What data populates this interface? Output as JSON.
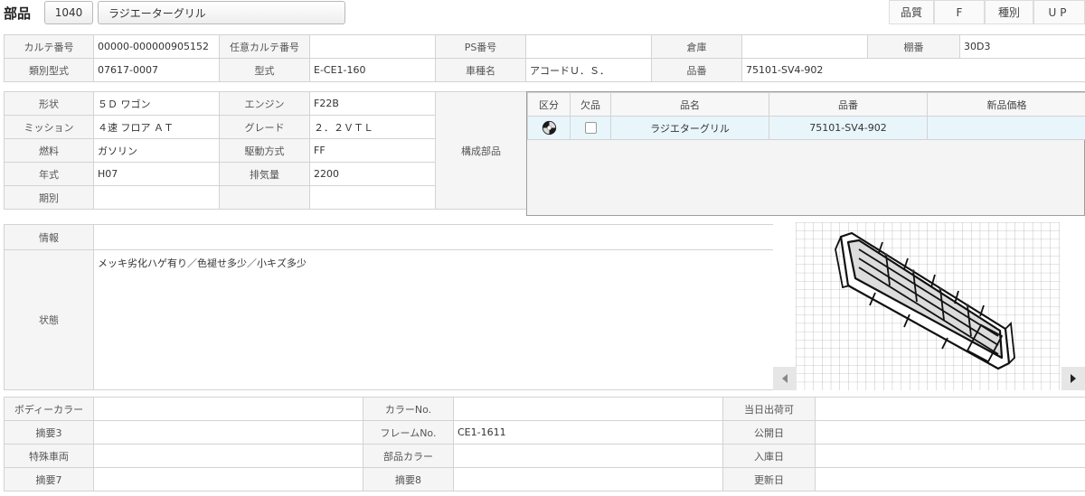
{
  "header": {
    "title": "部品",
    "part_id": "1040",
    "part_name": "ラジエーターグリル",
    "quality_label": "品質",
    "quality_value": "F",
    "kind_label": "種別",
    "kind_value": "UP"
  },
  "top": {
    "karte_no_label": "カルテ番号",
    "karte_no_value": "00000-000000905152",
    "optional_karte_label": "任意カルテ番号",
    "optional_karte_value": "",
    "ps_no_label": "PS番号",
    "ps_no_value": "",
    "warehouse_label": "倉庫",
    "warehouse_value": "",
    "shelf_label": "棚番",
    "shelf_value": "30D3",
    "type_spec_label": "類別型式",
    "type_spec_value": "07617-0007",
    "model_label": "型式",
    "model_value": "E-CE1-160",
    "vehicle_label": "車種名",
    "vehicle_value": "アコードＵ．Ｓ．",
    "part_no_label": "品番",
    "part_no_value": "75101-SV4-902"
  },
  "spec": {
    "shape_label": "形状",
    "shape_value": "５Ｄ ワゴン",
    "engine_label": "エンジン",
    "engine_value": "F22B",
    "mission_label": "ミッション",
    "mission_value": "４速 フロア ＡＴ",
    "grade_label": "グレード",
    "grade_value": "２．２ＶＴＬ",
    "fuel_label": "燃料",
    "fuel_value": "ガソリン",
    "drive_label": "駆動方式",
    "drive_value": "FF",
    "year_label": "年式",
    "year_value": "H07",
    "displacement_label": "排気量",
    "displacement_value": "2200",
    "period_label": "期別",
    "period_value": "",
    "components_label": "構成部品"
  },
  "parts_table": {
    "columns": [
      "区分",
      "欠品",
      "品名",
      "品番",
      "新品価格"
    ],
    "rows": [
      {
        "category_icon": "disc-icon",
        "missing": false,
        "name": "ラジエターグリル",
        "part_no": "75101-SV4-902",
        "price": ""
      }
    ]
  },
  "info": {
    "info_label": "情報",
    "info_value": "",
    "condition_label": "状態",
    "condition_value": "メッキ劣化ハゲ有り／色褪せ多少／小キズ多少"
  },
  "bottom": {
    "body_color_label": "ボディーカラー",
    "body_color_value": "",
    "color_no_label": "カラーNo.",
    "color_no_value": "",
    "same_day_label": "当日出荷可",
    "same_day_value": "",
    "memo3_label": "摘要3",
    "memo3_value": "",
    "frame_no_label": "フレームNo.",
    "frame_no_value": "CE1-1611",
    "public_date_label": "公開日",
    "public_date_value": "",
    "special_vehicle_label": "特殊車両",
    "special_vehicle_value": "",
    "part_color_label": "部品カラー",
    "part_color_value": "",
    "stock_date_label": "入庫日",
    "stock_date_value": "",
    "memo7_label": "摘要7",
    "memo7_value": "",
    "memo8_label": "摘要8",
    "memo8_value": "",
    "update_date_label": "更新日",
    "update_date_value": ""
  },
  "photo": {
    "image_icon": "radiator-grille-photo",
    "prev_icon": "chevron-left-icon",
    "next_icon": "chevron-right-icon"
  }
}
